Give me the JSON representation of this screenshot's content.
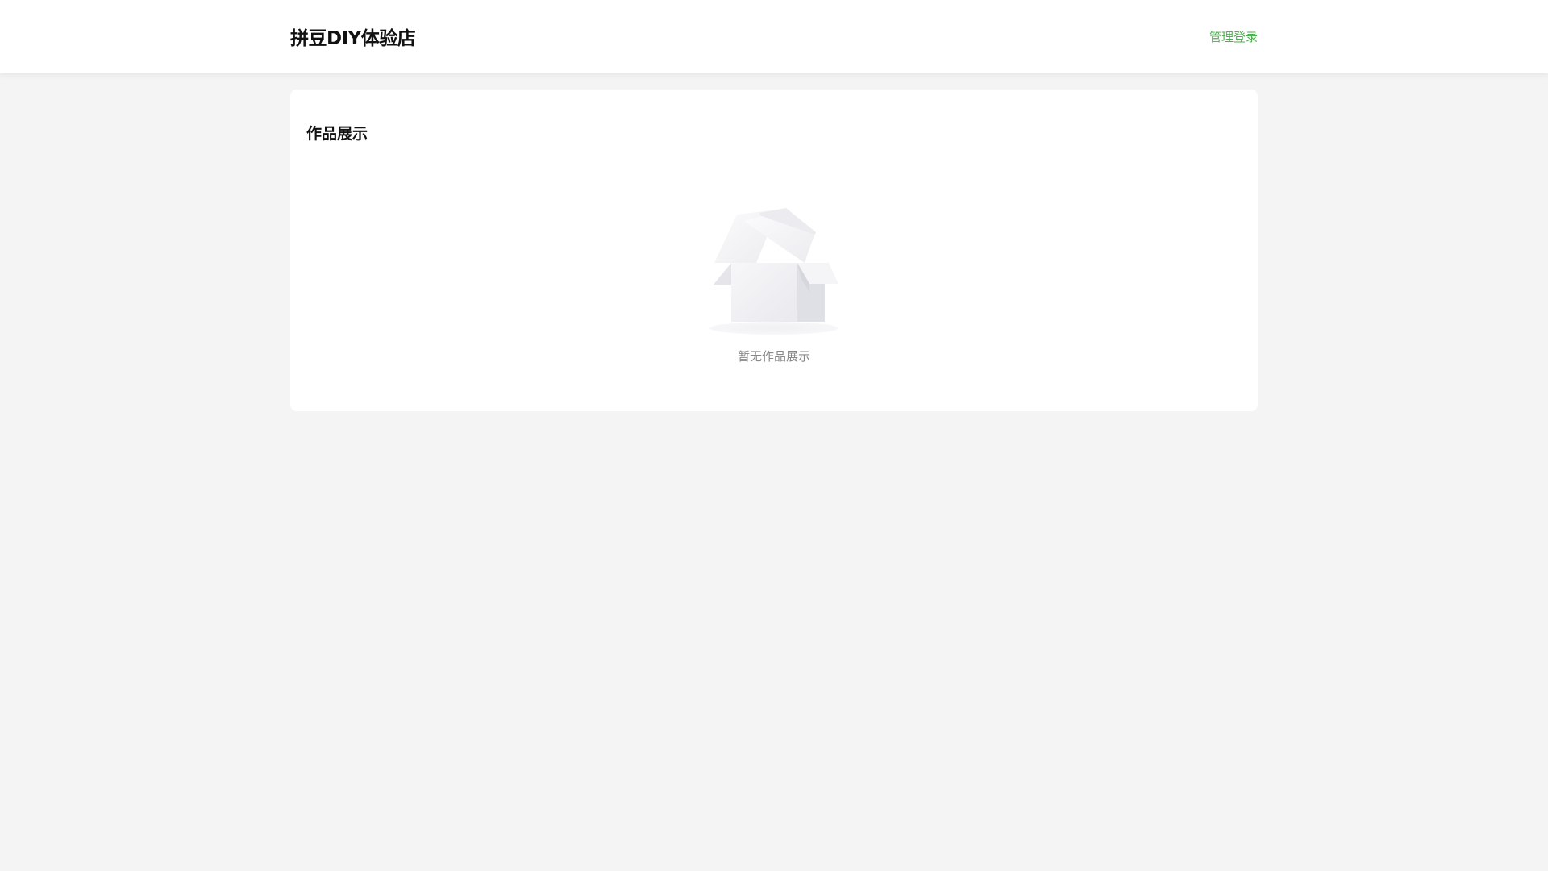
{
  "header": {
    "title": "拼豆DIY体验店",
    "login_link": "管理登录"
  },
  "gallery": {
    "title": "作品展示",
    "empty_text": "暂无作品展示",
    "empty_icon": "empty-box-icon"
  },
  "colors": {
    "accent": "#4caf50",
    "page_background": "#f4f4f4",
    "card_background": "#ffffff"
  }
}
